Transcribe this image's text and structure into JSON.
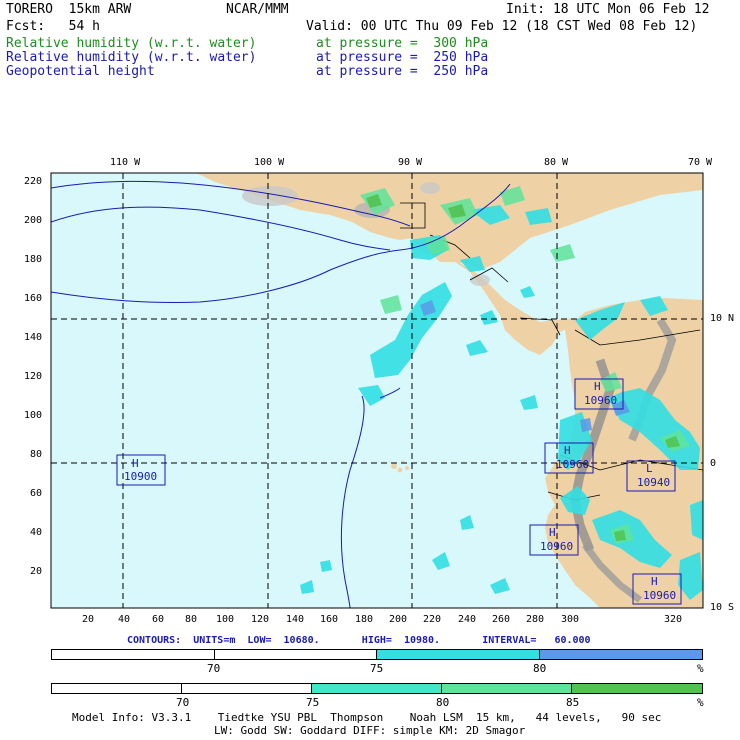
{
  "header": {
    "model": "TORERO  15km ARW",
    "org": "NCAR/MMM",
    "init": "Init: 18 UTC Mon 06 Feb 12",
    "fcst": "Fcst:   54 h",
    "valid": "Valid: 00 UTC Thu 09 Feb 12 (18 CST Wed 08 Feb 12)",
    "fields": [
      {
        "name": "Relative humidity (w.r.t. water)",
        "level": "at pressure =  300 hPa",
        "color": "#1e8c1e"
      },
      {
        "name": "Relative humidity (w.r.t. water)",
        "level": "at pressure =  250 hPa",
        "color": "#1a1ab4"
      },
      {
        "name": "Geopotential height",
        "level": "at pressure =  250 hPa",
        "color": "#1a1ab4"
      }
    ]
  },
  "map": {
    "lon_labels": [
      "110 W",
      "100 W",
      "90 W",
      "80 W",
      "70 W"
    ],
    "lat_labels": [
      "10 N",
      "0",
      "10 S"
    ],
    "x_ticks": [
      "20",
      "40",
      "60",
      "80",
      "100",
      "120",
      "140",
      "160",
      "180",
      "200",
      "220",
      "240",
      "260",
      "280",
      "300",
      "320"
    ],
    "y_ticks": [
      "20",
      "40",
      "60",
      "80",
      "100",
      "120",
      "140",
      "160",
      "180",
      "200",
      "220"
    ],
    "colors": {
      "ocean": "#d8f8fc",
      "land": "#eed2a6",
      "terrain_dark": "#9b9b9b",
      "terrain_light": "#d2d2d2",
      "rh_75": "#31dfe4",
      "rh_80": "#5a9ae6",
      "green_75": "#40e8c8",
      "green_80": "#5ee49a",
      "green_85": "#52c254",
      "contour": "#1a1ab4"
    },
    "height_labels": [
      {
        "type": "H",
        "value": "10900"
      },
      {
        "type": "H",
        "value": "10960"
      },
      {
        "type": "H",
        "value": "10960"
      },
      {
        "type": "L",
        "value": "10940"
      },
      {
        "type": "H",
        "value": "10960"
      },
      {
        "type": "H",
        "value": "10960"
      }
    ]
  },
  "contours_info": {
    "label": "CONTOURS:  UNITS=m  LOW=  10680.       HIGH=  10980.       INTERVAL=   60.000"
  },
  "legend_250": {
    "labels": [
      "70",
      "75",
      "80"
    ],
    "unit": "%",
    "colors": [
      "#ffffff",
      "#ffffff",
      "#31dfe4",
      "#5a9ae6"
    ]
  },
  "legend_300": {
    "labels": [
      "70",
      "75",
      "80",
      "85"
    ],
    "unit": "%",
    "colors": [
      "#ffffff",
      "#ffffff",
      "#40e8c8",
      "#5ee49a",
      "#52c254"
    ]
  },
  "footer": {
    "line1": "Model Info: V3.3.1    Tiedtke YSU PBL  Thompson    Noah LSM  15 km,   44 levels,   90 sec",
    "line2": "LW: Godd SW: Goddard DIFF: simple KM: 2D Smagor"
  }
}
